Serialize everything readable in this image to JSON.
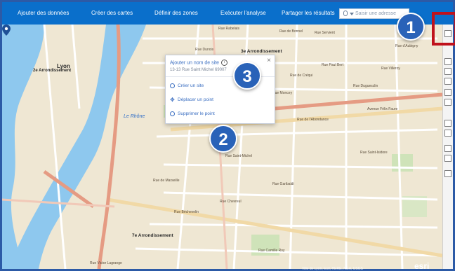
{
  "nav": {
    "items": [
      {
        "label": "Ajouter des données"
      },
      {
        "label": "Créer des cartes"
      },
      {
        "label": "Définir des zones"
      },
      {
        "label": "Exécuter l'analyse"
      },
      {
        "label": "Partager les résultats"
      }
    ],
    "search_placeholder": "Saisir une adresse"
  },
  "popup": {
    "title": "Ajouter un nom de site",
    "address": "13-13 Rue Saint Michel 69007",
    "actions": [
      {
        "label": "Créer un site",
        "icon": "target-icon"
      },
      {
        "label": "Déplacer un point",
        "icon": "move-icon"
      },
      {
        "label": "Supprimer le point",
        "icon": "delete-icon"
      }
    ]
  },
  "badges": [
    "1",
    "2",
    "3"
  ],
  "map": {
    "labels": {
      "lyon": "Lyon",
      "arr2": "2e Arrondissement",
      "arr3": "3e Arrondissement",
      "arr7": "7e Arrondissement",
      "rhone": "Le Rhône",
      "rue_dunois": "Rue Dunois",
      "rue_abondance": "Rue de l'Abondance",
      "rue_sully": "Avenue Félix Faure",
      "rue_garibaldi": "Rue Garibaldi",
      "rue_victor": "Rue Victor Lagrange",
      "rue_paul_bert": "Rue Paul Bert",
      "rue_servient": "Rue Servient",
      "rue_creqi": "Rue de Créqui",
      "rue_duguesclin": "Rue Duguesclin",
      "rue_marseille": "Rue de Marseille",
      "rue_bechevelin": "Rue Béchevelin",
      "rue_chevreul": "Rue Chevreul",
      "rue_saint_michel": "Rue Saint-Michel",
      "rue_bonnel": "Rue de Bonnel",
      "rue_moncey": "Rue Moncey",
      "rue_rabelais": "Rue Rabelais",
      "rue_aubigny": "Rue d'Aubigny",
      "rue_saint_isidore": "Rue Saint-Isidore",
      "rue_villeroy": "Rue Villeroy",
      "rue_camille_roy": "Rue Camille Roy"
    },
    "attribution": "Ville de Lyon, Esri, HERE, NGA, USGS",
    "logo": "esri"
  },
  "colors": {
    "nav_bg": "#0a6fcb",
    "badge": "#2962b8",
    "highlight": "#c0121c",
    "river": "#8ec8ee"
  }
}
